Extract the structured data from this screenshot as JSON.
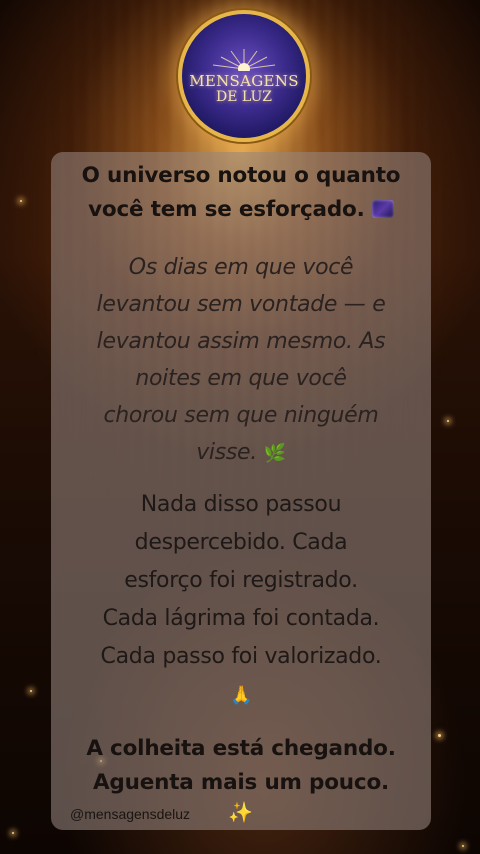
{
  "logo": {
    "line1": "MENSAGENS",
    "line2": "DE LUZ"
  },
  "post": {
    "headline_line1": "O universo notou o quanto",
    "headline_line2": "você tem se esforçado.",
    "italic_line1": "Os dias em que você",
    "italic_line2": "levantou sem vontade — e",
    "italic_line3": "levantou assim mesmo. As",
    "italic_line4": "noites em que você",
    "italic_line5": "chorou sem que ninguém",
    "italic_line6": "visse.",
    "italic_emoji": "🌿",
    "body_line1": "Nada disso passou",
    "body_line2": "despercebido. Cada",
    "body_line3": "esforço foi registrado.",
    "body_line4": "Cada lágrima foi contada.",
    "body_line5": "Cada passo foi valorizado.",
    "body_emoji": "🙏",
    "closing_line1": "A colheita está chegando.",
    "closing_line2": "Aguenta mais um pouco."
  },
  "footer": {
    "handle": "@mensagensdeluz",
    "sparkle": "✨"
  },
  "icons": {
    "headline_emoji": "milky-way-icon",
    "italic_emoji": "herb-icon",
    "body_emoji": "praying-hands-icon",
    "footer_emoji": "sparkles-icon"
  },
  "colors": {
    "logo_ring": "#e7b64a",
    "logo_fill": "#3a2a8a",
    "card": "#96847e",
    "text": "#17110f"
  }
}
